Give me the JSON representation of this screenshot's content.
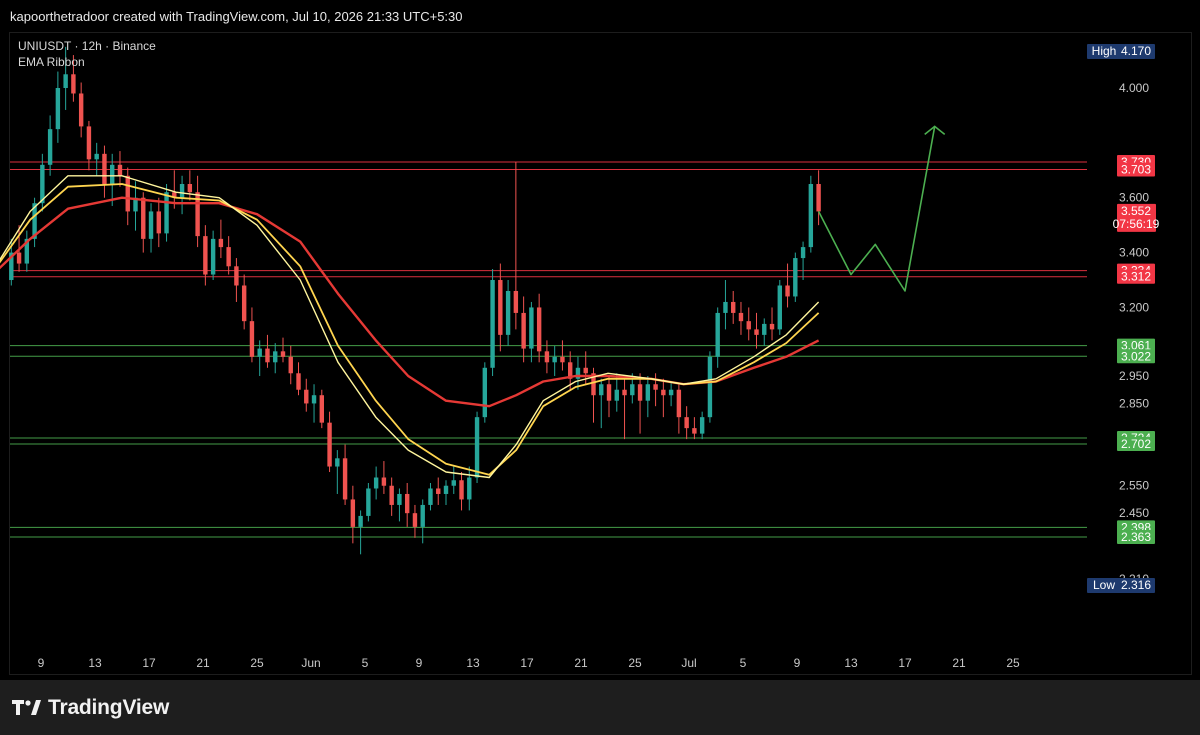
{
  "header": {
    "attribution": "kapoorthetradoor created with TradingView.com, Jul 10, 2026 21:33 UTC+5:30"
  },
  "legend": {
    "symbol": "UNIUSDT · 12h · Binance",
    "indicator": "EMA Ribbon"
  },
  "brand": {
    "name": "TradingView"
  },
  "colors": {
    "up": "#26a69a",
    "down": "#ef5350",
    "resistance": "#f23645",
    "support": "#4caf50",
    "tag_blue": "#1e3a6e",
    "ema_fast": "#fff59d",
    "ema_mid": "#ffd54f",
    "ema_slow": "#e53935",
    "projection": "#4caf50"
  },
  "chart_data": {
    "type": "candlestick",
    "ylim": [
      2.18,
      4.08
    ],
    "xlim": [
      8,
      26
    ],
    "x_ticks": [
      {
        "x": 9,
        "label": "9"
      },
      {
        "x": 10,
        "label": "13"
      },
      {
        "x": 11,
        "label": "17"
      },
      {
        "x": 12,
        "label": "21"
      },
      {
        "x": 13,
        "label": "25"
      },
      {
        "x": 14,
        "label": "Jun"
      },
      {
        "x": 15,
        "label": "5"
      },
      {
        "x": 16,
        "label": "9"
      },
      {
        "x": 17,
        "label": "13"
      },
      {
        "x": 18,
        "label": "17"
      },
      {
        "x": 19,
        "label": "21"
      },
      {
        "x": 20,
        "label": "25"
      },
      {
        "x": 21,
        "label": "Jul"
      },
      {
        "x": 22,
        "label": "5"
      },
      {
        "x": 23,
        "label": "9"
      },
      {
        "x": 24,
        "label": "13"
      },
      {
        "x": 25,
        "label": "17"
      },
      {
        "x": 26,
        "label": "21"
      },
      {
        "x": 27,
        "label": "25"
      }
    ],
    "y_ticks": [
      4.0,
      3.6,
      3.4,
      3.2,
      2.95,
      2.85,
      2.55,
      2.45,
      2.21
    ],
    "y_tick_labels": [
      "4.000",
      "3.600",
      "3.400",
      "3.200",
      "2.950",
      "2.850",
      "2.550",
      "2.450",
      "2.210"
    ],
    "levels": [
      {
        "value": 3.73,
        "label": "3.730",
        "kind": "resistance"
      },
      {
        "value": 3.703,
        "label": "3.703",
        "kind": "resistance"
      },
      {
        "value": 3.334,
        "label": "3.334",
        "kind": "resistance"
      },
      {
        "value": 3.312,
        "label": "3.312",
        "kind": "resistance"
      },
      {
        "value": 3.061,
        "label": "3.061",
        "kind": "support"
      },
      {
        "value": 3.022,
        "label": "3.022",
        "kind": "support"
      },
      {
        "value": 2.724,
        "label": "2.724",
        "kind": "support"
      },
      {
        "value": 2.702,
        "label": "2.702",
        "kind": "support"
      },
      {
        "value": 2.398,
        "label": "2.398",
        "kind": "support"
      },
      {
        "value": 2.363,
        "label": "2.363",
        "kind": "support"
      }
    ],
    "high": {
      "label": "High",
      "value": 4.17,
      "text": "4.170"
    },
    "low": {
      "label": "Low",
      "value": 2.316,
      "text": "2.316"
    },
    "last_price": {
      "value": 3.552,
      "text": "3.552",
      "countdown": "07:56:19"
    },
    "candles": [
      [
        3.3,
        3.45,
        3.28,
        3.4
      ],
      [
        3.4,
        3.5,
        3.33,
        3.36
      ],
      [
        3.36,
        3.48,
        3.33,
        3.45
      ],
      [
        3.45,
        3.6,
        3.42,
        3.58
      ],
      [
        3.58,
        3.76,
        3.55,
        3.72
      ],
      [
        3.72,
        3.9,
        3.68,
        3.85
      ],
      [
        3.85,
        4.06,
        3.8,
        4.0
      ],
      [
        4.0,
        4.15,
        3.92,
        4.05
      ],
      [
        4.05,
        4.12,
        3.95,
        3.98
      ],
      [
        3.98,
        4.02,
        3.82,
        3.86
      ],
      [
        3.86,
        3.88,
        3.7,
        3.74
      ],
      [
        3.74,
        3.8,
        3.68,
        3.76
      ],
      [
        3.76,
        3.79,
        3.6,
        3.65
      ],
      [
        3.65,
        3.76,
        3.57,
        3.72
      ],
      [
        3.72,
        3.77,
        3.64,
        3.68
      ],
      [
        3.68,
        3.71,
        3.5,
        3.55
      ],
      [
        3.55,
        3.66,
        3.48,
        3.6
      ],
      [
        3.6,
        3.62,
        3.4,
        3.45
      ],
      [
        3.45,
        3.58,
        3.4,
        3.55
      ],
      [
        3.55,
        3.6,
        3.42,
        3.47
      ],
      [
        3.47,
        3.65,
        3.44,
        3.62
      ],
      [
        3.62,
        3.7,
        3.56,
        3.6
      ],
      [
        3.6,
        3.68,
        3.54,
        3.65
      ],
      [
        3.65,
        3.7,
        3.59,
        3.62
      ],
      [
        3.62,
        3.68,
        3.42,
        3.46
      ],
      [
        3.46,
        3.5,
        3.28,
        3.32
      ],
      [
        3.32,
        3.48,
        3.3,
        3.45
      ],
      [
        3.45,
        3.52,
        3.38,
        3.42
      ],
      [
        3.42,
        3.46,
        3.32,
        3.35
      ],
      [
        3.35,
        3.38,
        3.22,
        3.28
      ],
      [
        3.28,
        3.32,
        3.12,
        3.15
      ],
      [
        3.15,
        3.2,
        3.0,
        3.02
      ],
      [
        3.02,
        3.08,
        2.95,
        3.05
      ],
      [
        3.05,
        3.1,
        2.98,
        3.0
      ],
      [
        3.0,
        3.07,
        2.96,
        3.04
      ],
      [
        3.04,
        3.09,
        3.0,
        3.02
      ],
      [
        3.02,
        3.06,
        2.92,
        2.96
      ],
      [
        2.96,
        3.0,
        2.88,
        2.9
      ],
      [
        2.9,
        2.94,
        2.82,
        2.85
      ],
      [
        2.85,
        2.92,
        2.78,
        2.88
      ],
      [
        2.88,
        2.9,
        2.76,
        2.78
      ],
      [
        2.78,
        2.82,
        2.6,
        2.62
      ],
      [
        2.62,
        2.68,
        2.52,
        2.65
      ],
      [
        2.65,
        2.7,
        2.48,
        2.5
      ],
      [
        2.5,
        2.55,
        2.34,
        2.4
      ],
      [
        2.4,
        2.46,
        2.3,
        2.44
      ],
      [
        2.44,
        2.56,
        2.42,
        2.54
      ],
      [
        2.54,
        2.62,
        2.5,
        2.58
      ],
      [
        2.58,
        2.64,
        2.52,
        2.55
      ],
      [
        2.55,
        2.58,
        2.44,
        2.48
      ],
      [
        2.48,
        2.54,
        2.42,
        2.52
      ],
      [
        2.52,
        2.56,
        2.4,
        2.45
      ],
      [
        2.45,
        2.48,
        2.36,
        2.4
      ],
      [
        2.4,
        2.5,
        2.34,
        2.48
      ],
      [
        2.48,
        2.56,
        2.46,
        2.54
      ],
      [
        2.54,
        2.58,
        2.48,
        2.52
      ],
      [
        2.52,
        2.57,
        2.48,
        2.55
      ],
      [
        2.55,
        2.62,
        2.52,
        2.57
      ],
      [
        2.57,
        2.6,
        2.46,
        2.5
      ],
      [
        2.5,
        2.62,
        2.46,
        2.58
      ],
      [
        2.58,
        2.82,
        2.56,
        2.8
      ],
      [
        2.8,
        3.0,
        2.78,
        2.98
      ],
      [
        2.98,
        3.34,
        2.95,
        3.3
      ],
      [
        3.3,
        3.36,
        3.04,
        3.1
      ],
      [
        3.1,
        3.3,
        3.06,
        3.26
      ],
      [
        3.26,
        3.73,
        3.12,
        3.18
      ],
      [
        3.18,
        3.24,
        3.0,
        3.05
      ],
      [
        3.05,
        3.22,
        3.0,
        3.2
      ],
      [
        3.2,
        3.25,
        3.0,
        3.04
      ],
      [
        3.04,
        3.08,
        2.96,
        3.0
      ],
      [
        3.0,
        3.06,
        2.95,
        3.02
      ],
      [
        3.02,
        3.08,
        2.97,
        3.0
      ],
      [
        3.0,
        3.04,
        2.9,
        2.94
      ],
      [
        2.94,
        3.02,
        2.9,
        2.98
      ],
      [
        2.98,
        3.04,
        2.92,
        2.96
      ],
      [
        2.96,
        2.98,
        2.78,
        2.88
      ],
      [
        2.88,
        2.94,
        2.76,
        2.92
      ],
      [
        2.92,
        2.95,
        2.8,
        2.86
      ],
      [
        2.86,
        2.96,
        2.82,
        2.9
      ],
      [
        2.9,
        2.94,
        2.72,
        2.88
      ],
      [
        2.88,
        2.96,
        2.85,
        2.92
      ],
      [
        2.92,
        2.96,
        2.74,
        2.86
      ],
      [
        2.86,
        2.95,
        2.8,
        2.92
      ],
      [
        2.92,
        2.96,
        2.84,
        2.9
      ],
      [
        2.9,
        2.94,
        2.8,
        2.88
      ],
      [
        2.88,
        2.93,
        2.84,
        2.9
      ],
      [
        2.9,
        2.92,
        2.74,
        2.8
      ],
      [
        2.8,
        2.84,
        2.72,
        2.76
      ],
      [
        2.76,
        2.8,
        2.72,
        2.74
      ],
      [
        2.74,
        2.82,
        2.72,
        2.8
      ],
      [
        2.8,
        3.04,
        2.78,
        3.02
      ],
      [
        3.02,
        3.2,
        2.98,
        3.18
      ],
      [
        3.18,
        3.3,
        3.12,
        3.22
      ],
      [
        3.22,
        3.26,
        3.14,
        3.18
      ],
      [
        3.18,
        3.22,
        3.1,
        3.15
      ],
      [
        3.15,
        3.2,
        3.08,
        3.12
      ],
      [
        3.12,
        3.18,
        3.05,
        3.1
      ],
      [
        3.1,
        3.16,
        3.06,
        3.14
      ],
      [
        3.14,
        3.2,
        3.08,
        3.12
      ],
      [
        3.12,
        3.3,
        3.1,
        3.28
      ],
      [
        3.28,
        3.36,
        3.2,
        3.24
      ],
      [
        3.24,
        3.4,
        3.22,
        3.38
      ],
      [
        3.38,
        3.44,
        3.3,
        3.42
      ],
      [
        3.42,
        3.68,
        3.4,
        3.65
      ],
      [
        3.65,
        3.7,
        3.5,
        3.55
      ]
    ],
    "candle_x_start": 8.45,
    "candle_x_end": 23.4,
    "ema_fast": [
      [
        8,
        3.3
      ],
      [
        8.8,
        3.55
      ],
      [
        9.5,
        3.68
      ],
      [
        10.5,
        3.68
      ],
      [
        11.5,
        3.62
      ],
      [
        12.3,
        3.6
      ],
      [
        13,
        3.5
      ],
      [
        13.8,
        3.3
      ],
      [
        14.5,
        3.0
      ],
      [
        15.2,
        2.8
      ],
      [
        15.8,
        2.68
      ],
      [
        16.5,
        2.6
      ],
      [
        17.3,
        2.58
      ],
      [
        17.8,
        2.7
      ],
      [
        18.3,
        2.86
      ],
      [
        18.9,
        2.93
      ],
      [
        19.5,
        2.96
      ],
      [
        20.3,
        2.94
      ],
      [
        20.9,
        2.92
      ],
      [
        21.5,
        2.94
      ],
      [
        22.2,
        3.02
      ],
      [
        22.8,
        3.1
      ],
      [
        23.4,
        3.22
      ]
    ],
    "ema_mid": [
      [
        8,
        3.3
      ],
      [
        8.8,
        3.52
      ],
      [
        9.5,
        3.64
      ],
      [
        10.5,
        3.65
      ],
      [
        11.5,
        3.6
      ],
      [
        12.3,
        3.59
      ],
      [
        13,
        3.52
      ],
      [
        13.8,
        3.35
      ],
      [
        14.5,
        3.06
      ],
      [
        15.2,
        2.86
      ],
      [
        15.8,
        2.72
      ],
      [
        16.5,
        2.63
      ],
      [
        17.3,
        2.59
      ],
      [
        17.8,
        2.68
      ],
      [
        18.3,
        2.84
      ],
      [
        18.9,
        2.91
      ],
      [
        19.5,
        2.94
      ],
      [
        20.3,
        2.94
      ],
      [
        20.9,
        2.92
      ],
      [
        21.5,
        2.93
      ],
      [
        22.2,
        3.0
      ],
      [
        22.8,
        3.07
      ],
      [
        23.4,
        3.18
      ]
    ],
    "ema_slow": [
      [
        8,
        3.3
      ],
      [
        8.8,
        3.45
      ],
      [
        9.5,
        3.56
      ],
      [
        10.5,
        3.6
      ],
      [
        11.5,
        3.58
      ],
      [
        12.3,
        3.58
      ],
      [
        13,
        3.54
      ],
      [
        13.8,
        3.44
      ],
      [
        14.5,
        3.25
      ],
      [
        15.2,
        3.08
      ],
      [
        15.8,
        2.95
      ],
      [
        16.5,
        2.86
      ],
      [
        17.3,
        2.84
      ],
      [
        17.8,
        2.88
      ],
      [
        18.3,
        2.93
      ],
      [
        18.9,
        2.95
      ],
      [
        19.5,
        2.95
      ],
      [
        20.3,
        2.94
      ],
      [
        20.9,
        2.92
      ],
      [
        21.5,
        2.93
      ],
      [
        22.2,
        2.98
      ],
      [
        22.8,
        3.02
      ],
      [
        23.4,
        3.08
      ]
    ],
    "projection": [
      [
        23.4,
        3.55
      ],
      [
        24.0,
        3.32
      ],
      [
        24.45,
        3.43
      ],
      [
        25.0,
        3.26
      ],
      [
        25.55,
        3.86
      ]
    ]
  }
}
